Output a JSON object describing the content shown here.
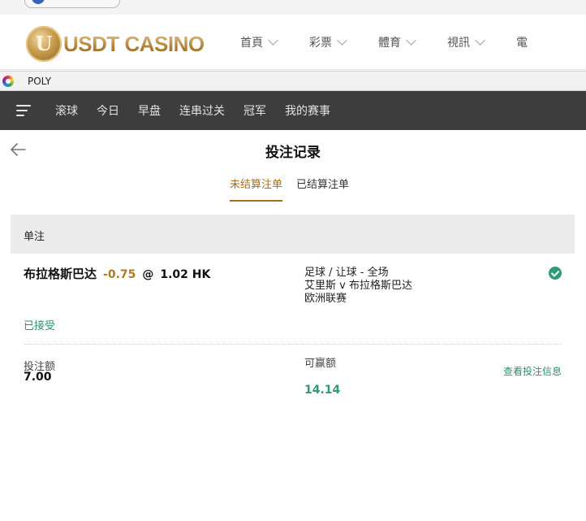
{
  "site_header": {
    "logo_text": "USDT CASINO",
    "nav": [
      "首頁",
      "彩票",
      "體育",
      "視訊",
      "電"
    ]
  },
  "frame_bar": {
    "title": "POLY"
  },
  "dark_nav": {
    "tabs": [
      "滚球",
      "今日",
      "早盘",
      "连串过关",
      "冠军",
      "我的赛事"
    ]
  },
  "page": {
    "title": "投注记录",
    "tabs": [
      {
        "label": "未结算注单",
        "active": true
      },
      {
        "label": "已结算注单",
        "active": false
      }
    ]
  },
  "section": {
    "heading": "单注",
    "bet": {
      "selection": "布拉格斯巴达",
      "handicap": "-0.75",
      "at": "@",
      "odds": "1.02 HK",
      "market": "足球 / 让球 - 全场",
      "match": "艾里斯 v 布拉格斯巴达",
      "league": "欧洲联赛",
      "status": "已接受",
      "stake_label": "投注额",
      "stake_value": "7.00",
      "win_label": "可赢额",
      "win_value": "14.14",
      "view_link": "查看投注信息"
    }
  },
  "colors": {
    "accent_gold": "#a66e1a",
    "accent_green": "#2f9a74",
    "dark_nav_bg": "#3d3d3d"
  }
}
